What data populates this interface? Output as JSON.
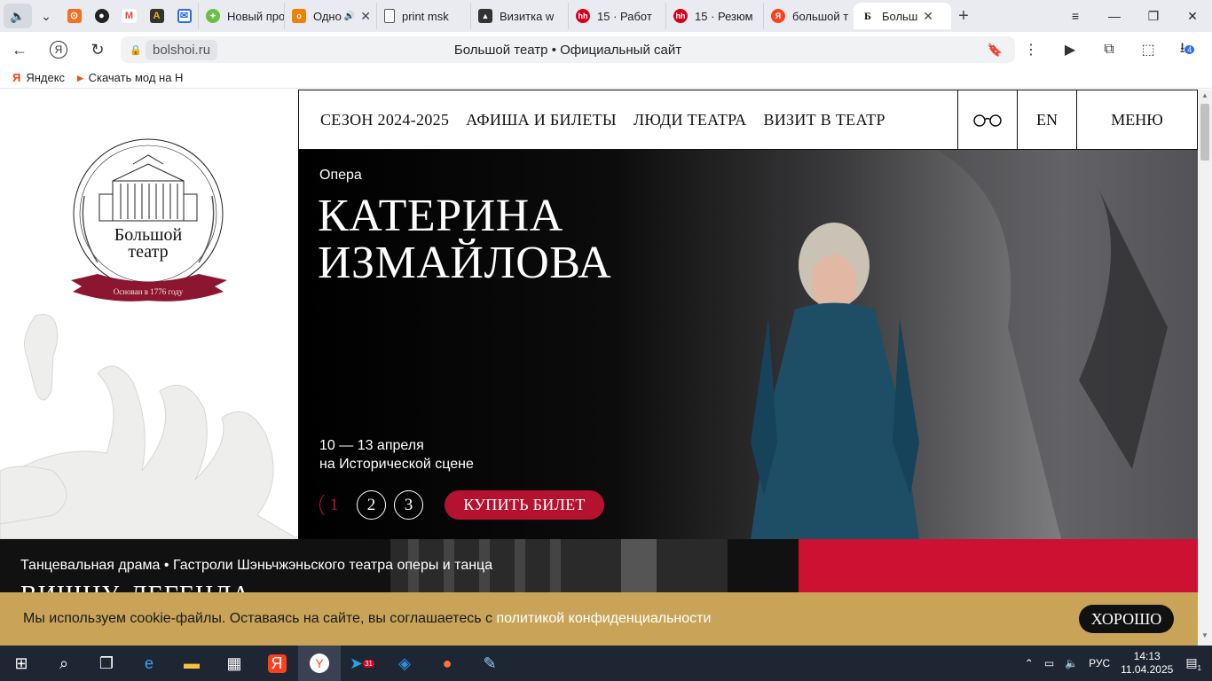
{
  "browser": {
    "tabs": [
      {
        "label": "Новый про",
        "color": "#6cbe45",
        "glyph": "✦"
      },
      {
        "label": "Одно",
        "color": "#ee8208",
        "glyph": "о"
      },
      {
        "label": "print msk",
        "color": "#ffffff",
        "glyph": "▯"
      },
      {
        "label": "Визитка w",
        "color": "#333333",
        "glyph": "▲"
      },
      {
        "label": "15 · Работ",
        "color": "#d6001c",
        "glyph": "hh"
      },
      {
        "label": "15 · Резюм",
        "color": "#d6001c",
        "glyph": "hh"
      },
      {
        "label": "большой т",
        "color": "#fc3f1d",
        "glyph": "Я"
      },
      {
        "label": "Больш",
        "color": "#ffffff",
        "glyph": "Б"
      }
    ],
    "url_domain": "bolshoi.ru",
    "page_title": "Большой театр • Официальный сайт",
    "bookmarks": [
      {
        "label": "Яндекс",
        "icon": "Я"
      },
      {
        "label": "Скачать мод на Н",
        "icon": "▸"
      }
    ],
    "downloads_badge": "4"
  },
  "site": {
    "nav": [
      "СЕЗОН 2024-2025",
      "АФИША И БИЛЕТЫ",
      "ЛЮДИ ТЕАТРА",
      "ВИЗИТ В ТЕАТР"
    ],
    "lang": "EN",
    "menu": "МЕНЮ",
    "logo": {
      "name_line1": "Большой",
      "name_line2": "театр",
      "ribbon": "Основан в 1776 году"
    },
    "hero": {
      "genre": "Опера",
      "title_line1": "КАТЕРИНА",
      "title_line2": "ИЗМАЙЛОВА",
      "dates": "10 — 13 апреля",
      "venue": "на Исторической сцене",
      "pages": [
        "1",
        "2",
        "3"
      ],
      "buy": "КУПИТЬ БИЛЕТ"
    },
    "next": {
      "genre": "Танцевальная драма",
      "sep": "•",
      "subtitle": "Гастроли Шэньчжэньского театра оперы и танца",
      "title": "ВИШНУ. ЛЕГЕНДА"
    },
    "cookie": {
      "text": "Мы используем cookie-файлы. Оставаясь на сайте, вы соглашаетесь с",
      "link": "политикой конфиденциальности",
      "ok": "ХОРОШО"
    }
  },
  "taskbar": {
    "telegram_badge": "31",
    "lang": "РУС",
    "time": "14:13",
    "date": "11.04.2025",
    "notif": "1"
  },
  "colors": {
    "accent_red": "#b5122f",
    "cookie_bg": "#c9a458",
    "strip_red": "#cc1133"
  }
}
